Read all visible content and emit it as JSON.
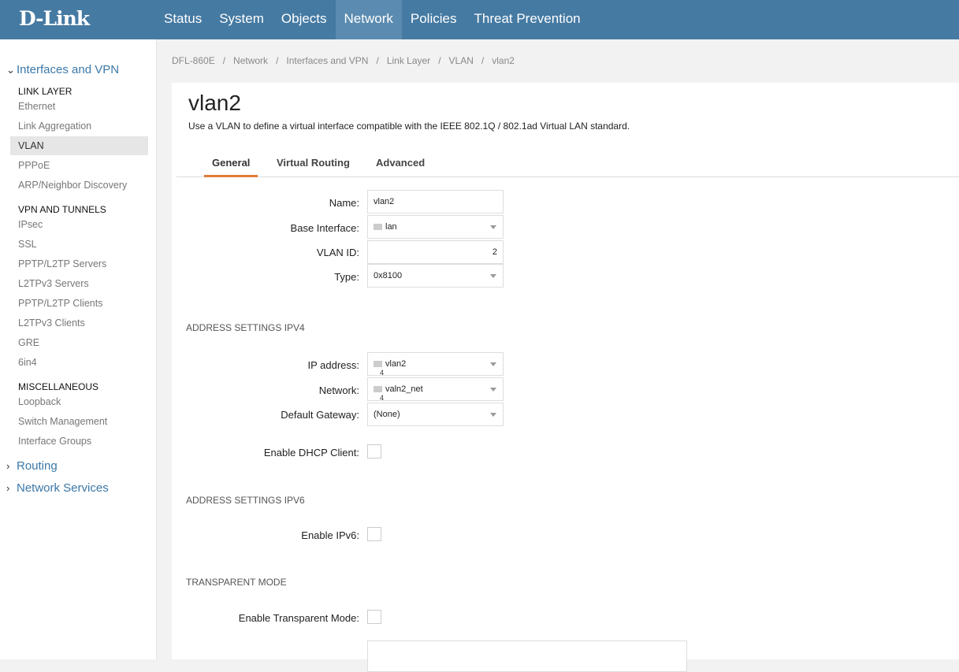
{
  "header": {
    "logo": "D-Link",
    "nav": [
      "Status",
      "System",
      "Objects",
      "Network",
      "Policies",
      "Threat Prevention"
    ],
    "active_nav": "Network"
  },
  "sidebar": {
    "group1": "Interfaces and VPN",
    "link_layer": {
      "heading": "LINK LAYER",
      "items": [
        "Ethernet",
        "Link Aggregation",
        "VLAN",
        "PPPoE",
        "ARP/Neighbor Discovery"
      ]
    },
    "vpn": {
      "heading": "VPN AND TUNNELS",
      "items": [
        "IPsec",
        "SSL",
        "PPTP/L2TP Servers",
        "L2TPv3 Servers",
        "PPTP/L2TP Clients",
        "L2TPv3 Clients",
        "GRE",
        "6in4"
      ]
    },
    "misc": {
      "heading": "MISCELLANEOUS",
      "items": [
        "Loopback",
        "Switch Management",
        "Interface Groups"
      ]
    },
    "group2": "Routing",
    "group3": "Network Services"
  },
  "breadcrumb": [
    "DFL-860E",
    "/",
    "Network",
    "/",
    "Interfaces and VPN",
    "/",
    "Link Layer",
    "/",
    "VLAN",
    "/",
    "vlan2"
  ],
  "page": {
    "title": "vlan2",
    "description": "Use a VLAN to define a virtual interface compatible with the IEEE 802.1Q / 802.1ad Virtual LAN standard."
  },
  "tabs": [
    "General",
    "Virtual Routing",
    "Advanced"
  ],
  "form": {
    "name_label": "Name:",
    "name_value": "vlan2",
    "base_label": "Base Interface:",
    "base_value": "lan",
    "vlanid_label": "VLAN ID:",
    "vlanid_value": "2",
    "type_label": "Type:",
    "type_value": "0x8100",
    "ipv4_heading": "ADDRESS SETTINGS IPV4",
    "ip_label": "IP address:",
    "ip_value": "vlan2",
    "net_label": "Network:",
    "net_value": "valn2_net",
    "gw_label": "Default Gateway:",
    "gw_value": "(None)",
    "dhcp_label": "Enable DHCP Client:",
    "ipv6_heading": "ADDRESS SETTINGS IPV6",
    "ipv6_label": "Enable IPv6:",
    "trans_heading": "TRANSPARENT MODE",
    "trans_label": "Enable Transparent Mode:",
    "ico_num": "4"
  }
}
